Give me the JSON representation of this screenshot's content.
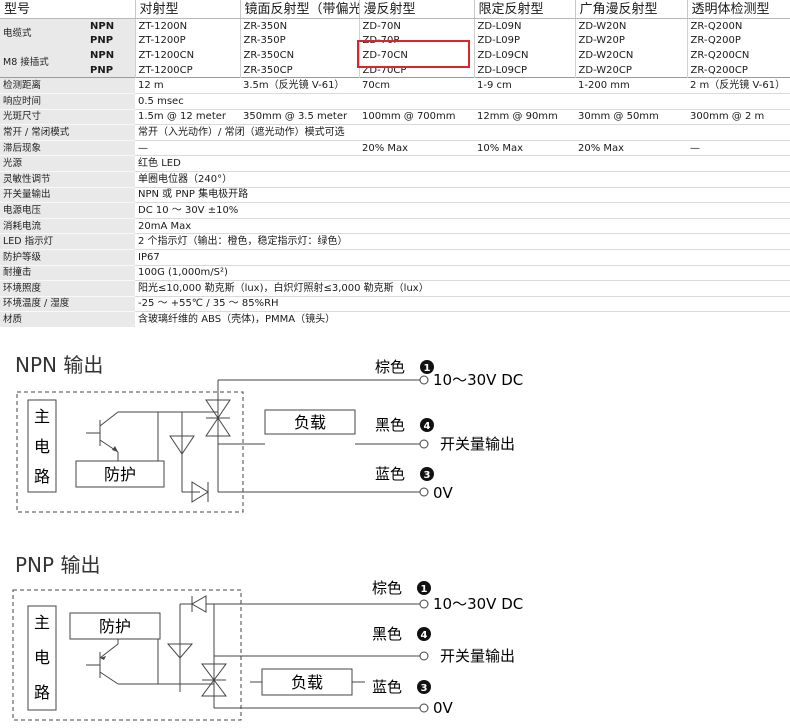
{
  "header": {
    "model": "型号",
    "cols": [
      "对射型",
      "镜面反射型（带偏光镜）",
      "漫反射型",
      "限定反射型",
      "广角漫反射型",
      "透明体检测型"
    ]
  },
  "model_rows": [
    {
      "group": "电缆式",
      "type": "NPN",
      "values": [
        "ZT-1200N",
        "ZR-350N",
        "ZD-70N",
        "ZD-L09N",
        "ZD-W20N",
        "ZR-Q200N"
      ]
    },
    {
      "group": "",
      "type": "PNP",
      "values": [
        "ZT-1200P",
        "ZR-350P",
        "ZD-70P",
        "ZD-L09P",
        "ZD-W20P",
        "ZR-Q200P"
      ]
    },
    {
      "group": "M8 接插式",
      "type": "NPN",
      "values": [
        "ZT-1200CN",
        "ZR-350CN",
        "ZD-70CN",
        "ZD-L09CN",
        "ZD-W20CN",
        "ZR-Q200CN"
      ]
    },
    {
      "group": "",
      "type": "PNP",
      "values": [
        "ZT-1200CP",
        "ZR-350CP",
        "ZD-70CP",
        "ZD-L09CP",
        "ZD-W20CP",
        "ZR-Q200CP"
      ]
    }
  ],
  "multi_rows": [
    {
      "label": "检测距离",
      "values": [
        "12 m",
        "3.5m（反光镜 V-61）",
        "70cm",
        "1-9 cm",
        "1-200 mm",
        "2 m（反光镜 V-61）"
      ]
    },
    {
      "label": "响应时间",
      "span": "0.5 msec"
    },
    {
      "label": "光斑尺寸",
      "values": [
        "1.5m @ 12 meter",
        "350mm @ 3.5 meter",
        "100mm @ 700mm",
        "12mm @ 90mm",
        "30mm @ 50mm",
        "300mm @ 2 m"
      ]
    },
    {
      "label": "常开 / 常闭模式",
      "span": "常开（入光动作）/ 常闭（遮光动作）模式可选"
    },
    {
      "label": "滞后现象",
      "values": [
        "—",
        "",
        "20% Max",
        "10% Max",
        "20% Max",
        "—"
      ]
    }
  ],
  "span_rows": [
    {
      "label": "光源",
      "value": "红色 LED"
    },
    {
      "label": "灵敏性调节",
      "value": "单圈电位器（240°）"
    },
    {
      "label": "开关量输出",
      "value": "NPN 或 PNP 集电极开路"
    },
    {
      "label": "电源电压",
      "value": "DC 10 ～ 30V ±10%"
    },
    {
      "label": "消耗电流",
      "value": "20mA Max"
    },
    {
      "label": "LED 指示灯",
      "value": "2 个指示灯（输出：橙色，稳定指示灯：绿色）"
    },
    {
      "label": "防护等级",
      "value": "IP67"
    },
    {
      "label": "耐撞击",
      "value": "100G (1,000m/S²)"
    },
    {
      "label": "环境照度",
      "value": "阳光≤10,000 勒克斯（lux)，白炽灯照射≤3,000 勒克斯（lux）"
    },
    {
      "label": "环境温度 / 湿度",
      "value": "-25 ～ +55℃ / 35 ～ 85%RH"
    },
    {
      "label": "材质",
      "value": "含玻璃纤维的 ABS（壳体)，PMMA（镜头）"
    }
  ],
  "npn": {
    "title": "NPN 输出",
    "main": [
      "主",
      "电",
      "路"
    ],
    "protect": "防护",
    "load": "负载",
    "wires": [
      {
        "color": "棕色",
        "pin": "1",
        "desc": "10～30V DC"
      },
      {
        "color": "黑色",
        "pin": "4",
        "desc": "开关量输出"
      },
      {
        "color": "蓝色",
        "pin": "3",
        "desc": "0V"
      }
    ]
  },
  "pnp": {
    "title": "PNP 输出",
    "main": [
      "主",
      "电",
      "路"
    ],
    "protect": "防护",
    "load": "负载",
    "wires": [
      {
        "color": "棕色",
        "pin": "1",
        "desc": "10～30V DC"
      },
      {
        "color": "黑色",
        "pin": "4",
        "desc": "开关量输出"
      },
      {
        "color": "蓝色",
        "pin": "3",
        "desc": "0V"
      }
    ]
  }
}
